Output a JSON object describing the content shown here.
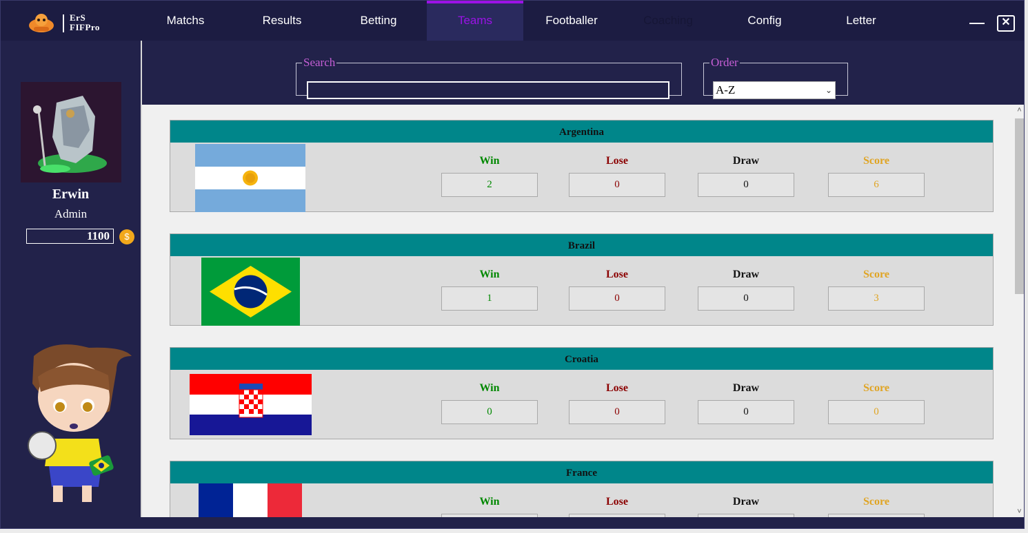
{
  "app": {
    "logo_line1": "ErS",
    "logo_line2": "FIFPro"
  },
  "nav": [
    {
      "label": "Matchs",
      "state": "normal"
    },
    {
      "label": "Results",
      "state": "normal"
    },
    {
      "label": "Betting",
      "state": "normal"
    },
    {
      "label": "Teams",
      "state": "active"
    },
    {
      "label": "Footballer",
      "state": "normal"
    },
    {
      "label": "Coaching",
      "state": "disabled"
    },
    {
      "label": "Config",
      "state": "normal"
    },
    {
      "label": "Letter",
      "state": "normal"
    }
  ],
  "window_controls": {
    "minimize_icon": "minimize-icon",
    "close_label": "✕"
  },
  "user": {
    "name": "Erwin",
    "role": "Admin",
    "coins": "1100",
    "coin_symbol": "$"
  },
  "search": {
    "legend": "Search",
    "value": "",
    "placeholder": ""
  },
  "order": {
    "legend": "Order",
    "selected": "A-Z"
  },
  "stat_labels": {
    "win": "Win",
    "lose": "Lose",
    "draw": "Draw",
    "score": "Score"
  },
  "teams": [
    {
      "name": "Argentina",
      "flag": "argentina-flag",
      "win": "2",
      "lose": "0",
      "draw": "0",
      "score": "6"
    },
    {
      "name": "Brazil",
      "flag": "brazil-flag",
      "win": "1",
      "lose": "0",
      "draw": "0",
      "score": "3"
    },
    {
      "name": "Croatia",
      "flag": "croatia-flag",
      "win": "0",
      "lose": "0",
      "draw": "0",
      "score": "0"
    },
    {
      "name": "France",
      "flag": "france-flag",
      "win": "",
      "lose": "",
      "draw": "",
      "score": ""
    }
  ],
  "colors": {
    "header_teal": "#00868a",
    "accent_purple": "#9b12e6",
    "win": "#008800",
    "lose": "#8b0000",
    "score": "#e0a422",
    "bg_navy": "#22224a"
  }
}
